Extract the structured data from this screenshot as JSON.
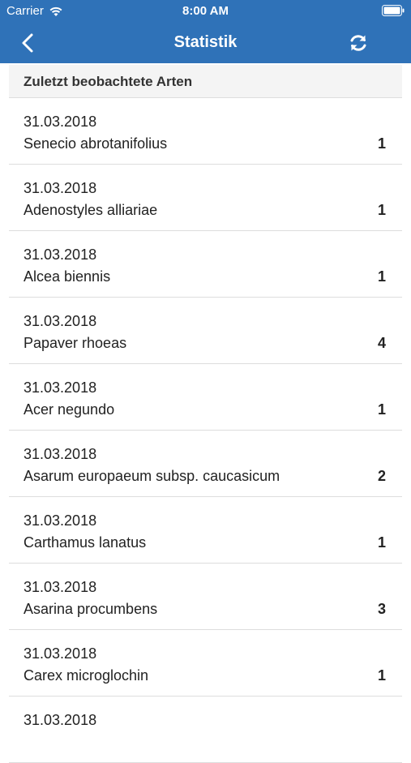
{
  "status_bar": {
    "carrier": "Carrier",
    "time": "8:00 AM"
  },
  "nav": {
    "title": "Statistik",
    "back_icon": "chevron-left-icon",
    "refresh_icon": "refresh-icon"
  },
  "colors": {
    "nav_background": "#2f72b8",
    "section_background": "#f4f4f4"
  },
  "section": {
    "title": "Zuletzt beobachtete Arten"
  },
  "observations": [
    {
      "date": "31.03.2018",
      "species": "Senecio abrotanifolius",
      "count": "1"
    },
    {
      "date": "31.03.2018",
      "species": "Adenostyles alliariae",
      "count": "1"
    },
    {
      "date": "31.03.2018",
      "species": "Alcea biennis",
      "count": "1"
    },
    {
      "date": "31.03.2018",
      "species": "Papaver rhoeas",
      "count": "4"
    },
    {
      "date": "31.03.2018",
      "species": "Acer negundo",
      "count": "1"
    },
    {
      "date": "31.03.2018",
      "species": "Asarum europaeum subsp. caucasicum",
      "count": "2"
    },
    {
      "date": "31.03.2018",
      "species": "Carthamus lanatus",
      "count": "1"
    },
    {
      "date": "31.03.2018",
      "species": "Asarina procumbens",
      "count": "3"
    },
    {
      "date": "31.03.2018",
      "species": "Carex microglochin",
      "count": "1"
    },
    {
      "date": "31.03.2018",
      "species": "",
      "count": ""
    }
  ]
}
